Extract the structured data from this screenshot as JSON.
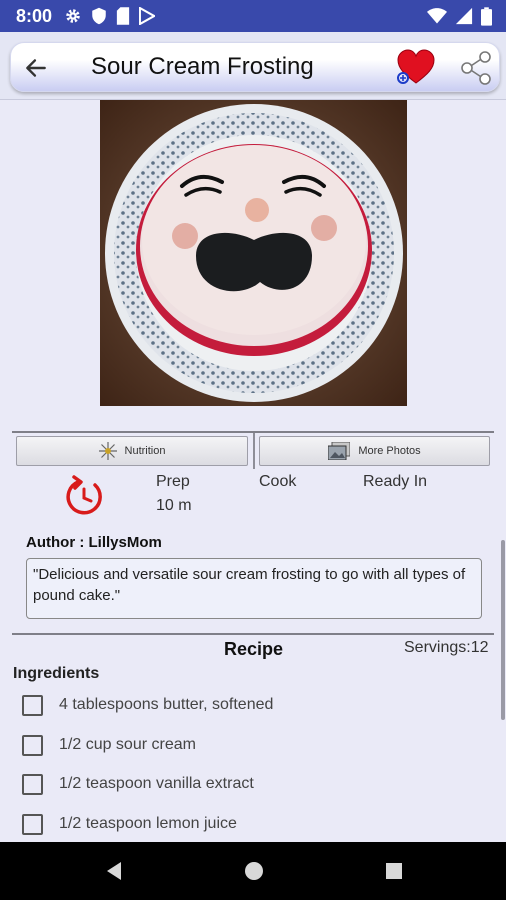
{
  "status_bar": {
    "time": "8:00",
    "icons_left": [
      "gear-icon",
      "shield-icon",
      "sd-card-icon",
      "play-store-icon"
    ],
    "icons_right": [
      "wifi-icon",
      "signal-icon",
      "battery-icon"
    ]
  },
  "app_bar": {
    "title": "Sour Cream Frosting",
    "back_icon": "arrow-left-icon",
    "favorite_icon": "heart-icon",
    "share_icon": "share-icon"
  },
  "tabs": {
    "nutrition_label": "Nutrition",
    "more_photos_label": "More Photos"
  },
  "times": {
    "prep_label": "Prep",
    "prep_value": "10 m",
    "cook_label": "Cook",
    "ready_label": "Ready In"
  },
  "author": "Author : LillysMom",
  "description": "\"Delicious and versatile sour cream frosting to go with all types of pound cake.\"",
  "recipe": {
    "title": "Recipe",
    "servings": "Servings:12",
    "ingredients_title": "Ingredients",
    "ingredients": [
      "4 tablespoons butter, softened",
      "1/2 cup sour cream",
      "1/2 teaspoon vanilla extract",
      "1/2 teaspoon lemon juice"
    ]
  },
  "colors": {
    "status_bar": "#3949ab",
    "heart": "#e01020",
    "timer": "#d81b1b"
  }
}
